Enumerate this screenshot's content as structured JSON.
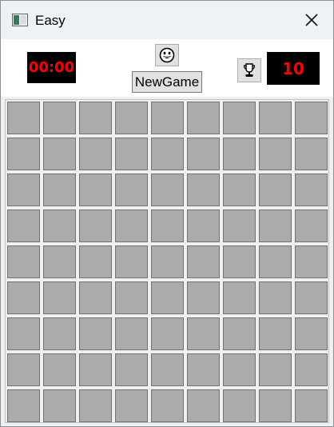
{
  "window": {
    "title": "Easy",
    "app_icon": "window-app-icon",
    "close_icon": "close-icon"
  },
  "toolbar": {
    "timer": "00:00",
    "mine_counter": "10",
    "new_game_label": "NewGame",
    "smiley_icon": "smiley-face-icon",
    "trophy_icon": "trophy-icon"
  },
  "board": {
    "rows": 9,
    "columns": 9,
    "cell_state": "covered"
  },
  "colors": {
    "counter_background": "#000000",
    "counter_text": "#ff0000",
    "cell_fill": "#ababab",
    "cell_border": "#727272"
  }
}
